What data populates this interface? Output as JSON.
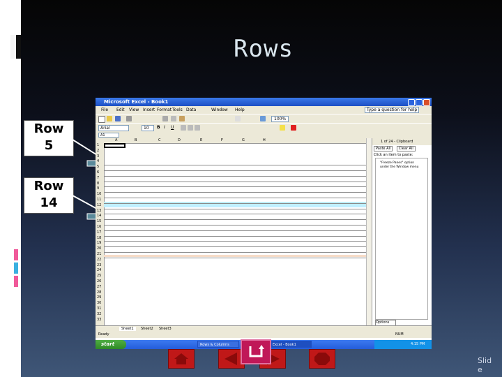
{
  "slide": {
    "title": "Rows",
    "slide_number_label": "Slid\ne",
    "callouts": [
      {
        "label": "Row\n5"
      },
      {
        "label": "Row\n14"
      }
    ]
  },
  "excel": {
    "window_title": "Microsoft Excel - Book1",
    "menu": [
      "File",
      "Edit",
      "View",
      "Insert",
      "Format",
      "Tools",
      "Data",
      "Window",
      "Help"
    ],
    "help_box_placeholder": "Type a question for help",
    "font_name": "Arial",
    "font_size": "10",
    "zoom": "100%",
    "name_box": "A1",
    "columns": [
      "A",
      "B",
      "C",
      "D",
      "E",
      "F",
      "G",
      "H"
    ],
    "rows": [
      "1",
      "2",
      "3",
      "4",
      "5",
      "6",
      "7",
      "8",
      "9",
      "10",
      "11",
      "12",
      "13",
      "14",
      "15",
      "16",
      "17",
      "18",
      "19",
      "20",
      "21",
      "22",
      "23",
      "24",
      "25",
      "26",
      "27",
      "28",
      "29",
      "30",
      "31",
      "32",
      "33"
    ],
    "task_pane": {
      "header": "1 of 24 - Clipboard",
      "paste_all": "Paste All",
      "clear_all": "Clear All",
      "click_item_label": "Click an item to paste:",
      "clip_item_text": "\"Freeze Panes\" option under the Window menu",
      "options_label": "Options"
    },
    "sheet_tabs": [
      "Sheet1",
      "Sheet2",
      "Sheet3"
    ],
    "status": "Ready",
    "status_mode": "NUM"
  },
  "taskbar": {
    "start_label": "start",
    "items": [
      "Rows & Columns",
      "Excel - Book1"
    ],
    "clock": "4:15 PM"
  },
  "nav": {
    "home_icon": "home-icon",
    "prev_icon": "left-arrow-icon",
    "next_icon": "right-arrow-icon",
    "return_icon": "return-arrow-icon",
    "end_icon": "stop-icon"
  }
}
